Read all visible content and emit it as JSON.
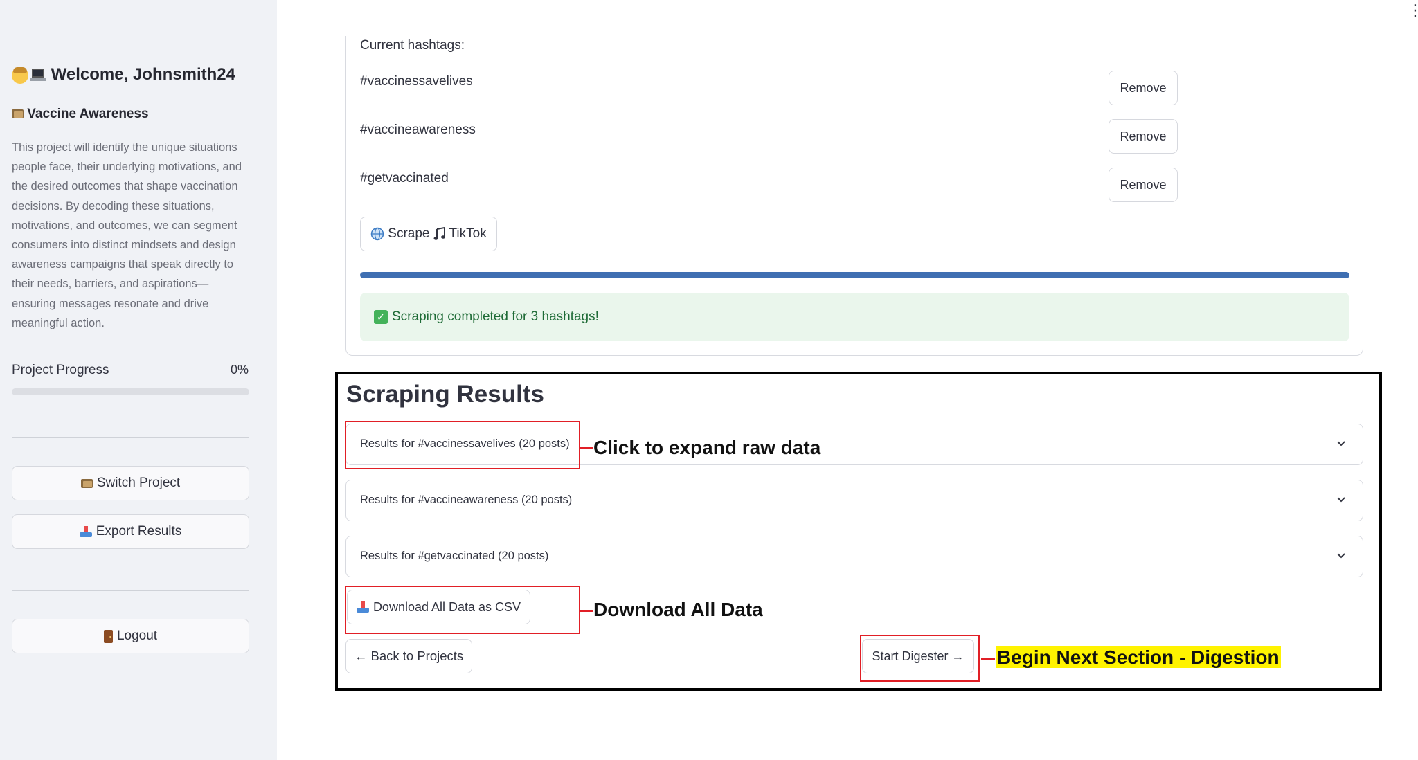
{
  "sidebar": {
    "welcome": "Welcome, Johnsmith24",
    "project_title": "Vaccine Awareness",
    "project_description": "This project will identify the unique situations people face, their underlying motivations, and the desired outcomes that shape vaccination decisions. By decoding these situations, motivations, and outcomes, we can segment consumers into distinct mindsets and design awareness campaigns that speak directly to their needs, barriers, and aspirations—ensuring messages resonate and drive meaningful action.",
    "progress_label": "Project Progress",
    "progress_text": "0%",
    "progress_value": 0,
    "switch_project_label": "Switch Project",
    "export_results_label": "Export Results",
    "logout_label": "Logout"
  },
  "hashtags": {
    "current_label": "Current hashtags:",
    "items": [
      {
        "tag": "#vaccinessavelives",
        "remove_label": "Remove"
      },
      {
        "tag": "#vaccineawareness",
        "remove_label": "Remove"
      },
      {
        "tag": "#getvaccinated",
        "remove_label": "Remove"
      }
    ],
    "scrape_prefix": "Scrape",
    "scrape_label": "TikTok",
    "scrape_progress": 1.0,
    "success_message": "Scraping completed for 3 hashtags!"
  },
  "results": {
    "title": "Scraping Results",
    "expanders": [
      {
        "label": "Results for #vaccinessavelives (20 posts)"
      },
      {
        "label": "Results for #vaccineawareness (20 posts)"
      },
      {
        "label": "Results for #getvaccinated (20 posts)"
      }
    ],
    "download_label": "Download All Data as CSV",
    "back_label": "← Back to Projects",
    "start_digester_label": "Start Digester →"
  },
  "annotations": {
    "expand": "Click to expand raw data",
    "download": "Download All Data",
    "next": "Begin Next Section - Digestion"
  },
  "colors": {
    "accent": "#3f6fb2",
    "annotation_box": "#e11f26",
    "highlight": "#fff300",
    "success_bg": "#eaf6ec",
    "success_text": "#1e6b36",
    "sidebar_bg": "#f0f2f6"
  },
  "icons": {
    "welcome": [
      "face-icon",
      "laptop-icon"
    ],
    "project": "folder-icon",
    "switch": "folder-icon",
    "export": "inbox-tray-icon",
    "logout": "door-icon",
    "scrape": [
      "globe-icon",
      "music-note-icon"
    ],
    "success": "check-mark-icon",
    "expander": "chevron-down-icon",
    "download": "inbox-tray-icon"
  }
}
